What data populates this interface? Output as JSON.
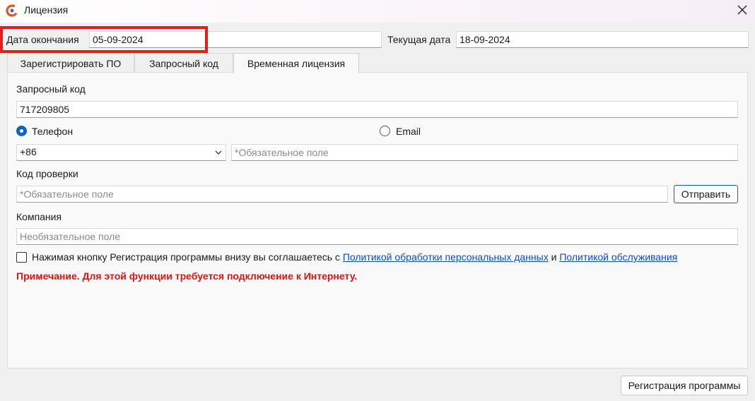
{
  "window": {
    "title": "Лицензия"
  },
  "header": {
    "expiry_label": "Дата окончания",
    "expiry_value": "05-09-2024",
    "current_label": "Текущая дата",
    "current_value": "18-09-2024"
  },
  "tabs": [
    {
      "label": "Зарегистрировать ПО"
    },
    {
      "label": "Запросный код"
    },
    {
      "label": "Временная лицензия",
      "active": true
    }
  ],
  "form": {
    "request_code_label": "Запросный код",
    "request_code_value": "717209805",
    "radio_phone_label": "Телефон",
    "radio_email_label": "Email",
    "radio_selected": "Телефон",
    "country_code": "+86",
    "phone_placeholder": "*Обязательное поле",
    "verify_label": "Код проверки",
    "verify_placeholder": "*Обязательное поле",
    "send_button": "Отправить",
    "company_label": "Компания",
    "company_placeholder": "Необязательное поле",
    "consent_text": "Нажимая кнопку Регистрация программы внизу вы соглашаетесь с",
    "consent_link1": "Политикой обработки персональных данных",
    "consent_and": "и",
    "consent_link2": "Политикой обслуживания",
    "consent_checked": false,
    "note": "Примечание. Для этой функции требуется подключение к Интернету."
  },
  "footer": {
    "register_button": "Регистрация программы"
  },
  "colors": {
    "accent": "#0a64c8",
    "highlight": "#e0201b",
    "note": "#e01212",
    "link": "#0a4fcc"
  }
}
